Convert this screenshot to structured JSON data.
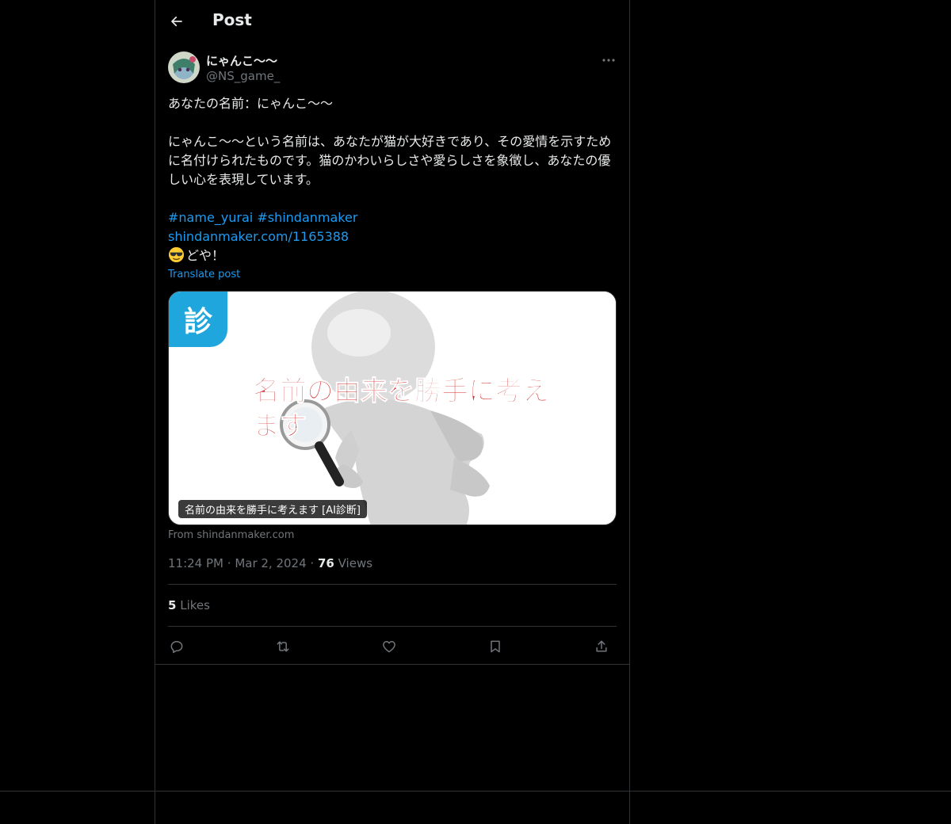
{
  "colors": {
    "background": "#000000",
    "text": "#e7e9ea",
    "muted": "#71767b",
    "link": "#1d9bf0",
    "border": "#2f3336",
    "card_accent": "#1fa6dc",
    "card_headline": "#d42a2a"
  },
  "header": {
    "title": "Post",
    "back_icon": "arrow-left-icon"
  },
  "author": {
    "display_name": "にゃんこ〜〜",
    "handle": "@NS_game_"
  },
  "tweet": {
    "line1": "あなたの名前：にゃんこ〜〜",
    "body": "にゃんこ〜〜という名前は、あなたが猫が大好きであり、その愛情を示すために名付けられたものです。猫のかわいらしさや愛らしさを象徴し、あなたの優しい心を表現しています。",
    "hashtag1": "#name_yurai",
    "hashtag2": "#shindanmaker",
    "link": "shindanmaker.com/1165388",
    "closing": "どや！",
    "emoji": "smiling-face-with-sunglasses",
    "translate": "Translate post"
  },
  "card": {
    "badge": "診",
    "headline": "名前の由来を勝手に考えます",
    "caption": "名前の由来を勝手に考えます [AI診断]",
    "source": "From shindanmaker.com"
  },
  "meta": {
    "time": "11:24 PM",
    "date": "Mar 2, 2024",
    "views_count": "76",
    "views_label": "Views"
  },
  "likes": {
    "count": "5",
    "label": "Likes"
  },
  "actions": [
    "reply-icon",
    "repost-icon",
    "like-icon",
    "bookmark-icon",
    "share-icon"
  ]
}
